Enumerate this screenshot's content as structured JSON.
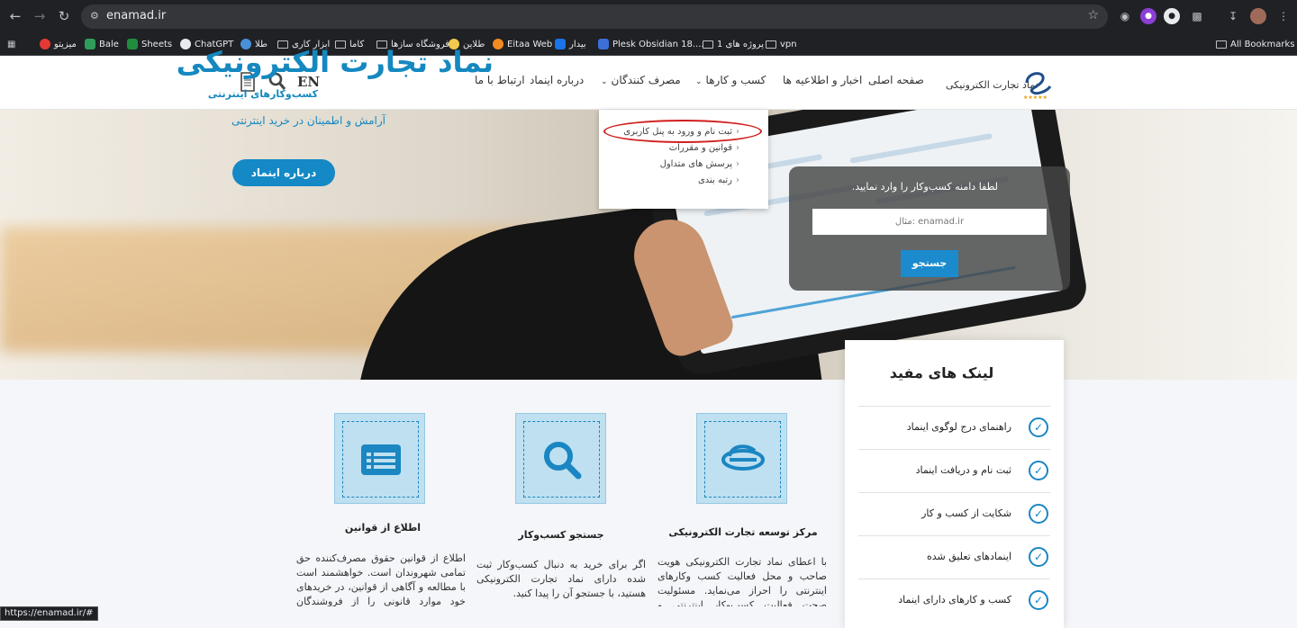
{
  "browser": {
    "url": "enamad.ir",
    "status_url": "https://enamad.ir/#",
    "bookmarks": [
      "میزیتو",
      "Bale",
      "Sheets",
      "ChatGPT",
      "طلا",
      "ابزار کاری",
      "کاما",
      "فروشگاه سازها",
      "طلاین",
      "Eitaa Web",
      "بیدار",
      "Plesk Obsidian 18....",
      "پروژه های 1",
      "vpn"
    ],
    "all_bookmarks": "All Bookmarks"
  },
  "header": {
    "logo_text": "نماد تجارت الکترونیکی",
    "nav": [
      "صفحه اصلی",
      "اخبار و اطلاعیه ها",
      "کسب و کارها",
      "مصرف کنندگان",
      "درباره اینماد",
      "ارتباط با ما"
    ],
    "lang": "EN"
  },
  "dropdown": {
    "items": [
      "ثبت نام و ورود به پنل کاربری",
      "قوانین و مقررات",
      "پرسش های متداول",
      "رتبه بندی"
    ]
  },
  "hero": {
    "title": "نماد تجارت الکترونیکی",
    "subtitle": "کسب‌وکارهای اینترنتی",
    "tagline": "آرامش و اطمینان در خرید اینترنتی",
    "button": "درباره اینماد"
  },
  "search": {
    "prompt": "لطفا دامنه کسب‌وکار را وارد نمایید.",
    "placeholder": "مثال: enamad.ir",
    "button": "جستجو"
  },
  "cards": [
    {
      "title": "مرکز توسعه تجارت الکترونیکی",
      "text": "با اعطای نماد تجارت الکترونیکی هویت صاحب و محل فعالیت کسب وکارهای اینترنتی را احراز می‌نماید. مسئولیت صحت فعالیت کسب‌وکار اینترنتی و محتوای"
    },
    {
      "title": "جستجو کسب‌وکار",
      "text": "اگر برای خرید به دنبال کسب‌وکار ثبت شده دارای نماد تجارت الکترونیکی هستید، با جستجو آن را پیدا کنید."
    },
    {
      "title": "اطلاع از قوانین",
      "text": "اطلاع از قوانین حقوق مصرف‌کننده حق تمامی شهروندان است. خواهشمند است با مطالعه و آگاهی از قوانین، در خریدهای خود موارد قانونی را از فروشندگان مطالبه نمایند."
    }
  ],
  "useful_links": {
    "title": "لینک های مفید",
    "items": [
      "راهنمای درج لوگوی اینماد",
      "ثبت نام و دریافت اینماد",
      "شکایت از کسب و کار",
      "اینمادهای تعلیق شده",
      "کسب و کارهای دارای اینماد"
    ]
  },
  "colors": {
    "brand": "#1489c5",
    "highlight": "#d12020"
  }
}
